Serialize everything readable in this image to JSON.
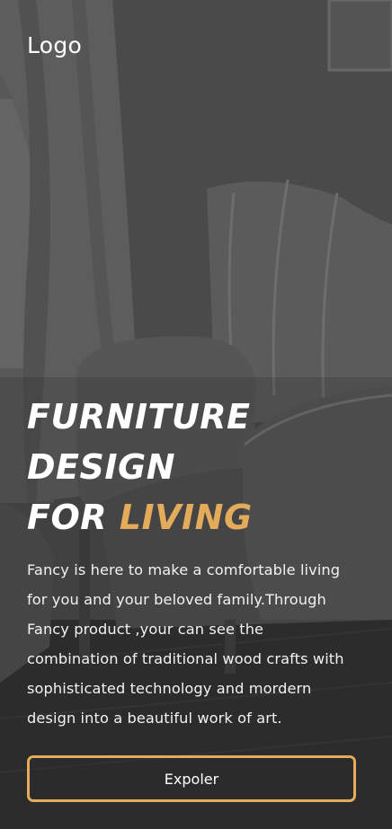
{
  "header": {
    "logo": "Logo"
  },
  "hero": {
    "title_line_1": "FURNITURE",
    "title_line_2": "DESIGN",
    "title_line_3_prefix": "FOR ",
    "title_line_3_accent": "LIVING",
    "description_lines": [
      "Fancy is here to  make a comfortable living",
      "for you and  your beloved  family.Through",
      "Fancy product ,your can see the",
      "combination of traditional wood  crafts with",
      "sophisticated technology and mordern",
      "design into a beautiful work of art."
    ],
    "cta_label": "Expoler"
  },
  "colors": {
    "accent": "#e3ab5a",
    "text": "#ffffff"
  }
}
